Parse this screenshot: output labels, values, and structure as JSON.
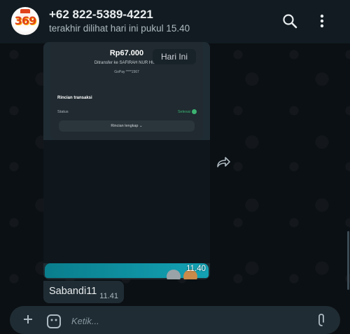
{
  "header": {
    "contact_name": "+62 822-5389-4221",
    "last_seen": "terakhir dilihat hari ini pukul 15.40",
    "avatar_text": "369"
  },
  "chat": {
    "day_chip": "Hari Ini",
    "image_message": {
      "receipt": {
        "amount": "Rp67.000",
        "transfer_to": "Ditransfer ke SAFIRAH NUR HIDA",
        "gopay": "GoPay ****1567",
        "detail_title": "Rincian transaksi",
        "status_label": "Status",
        "status_value": "Selesai",
        "full_detail": "Rincian lengkap"
      },
      "bottom_text": "",
      "time": "11.40"
    },
    "text_message": {
      "text": "Sabandi11",
      "time": "11.41"
    }
  },
  "input": {
    "placeholder": "Ketik..."
  },
  "colors": {
    "header_bg": "#111b21",
    "bubble_bg": "#1f2c33",
    "accent_teal": "#13a2b4",
    "status_green": "#3cb371"
  },
  "icons": [
    "search-icon",
    "more-vert-icon",
    "forward-icon",
    "plus-icon",
    "sticker-icon",
    "attach-icon"
  ]
}
